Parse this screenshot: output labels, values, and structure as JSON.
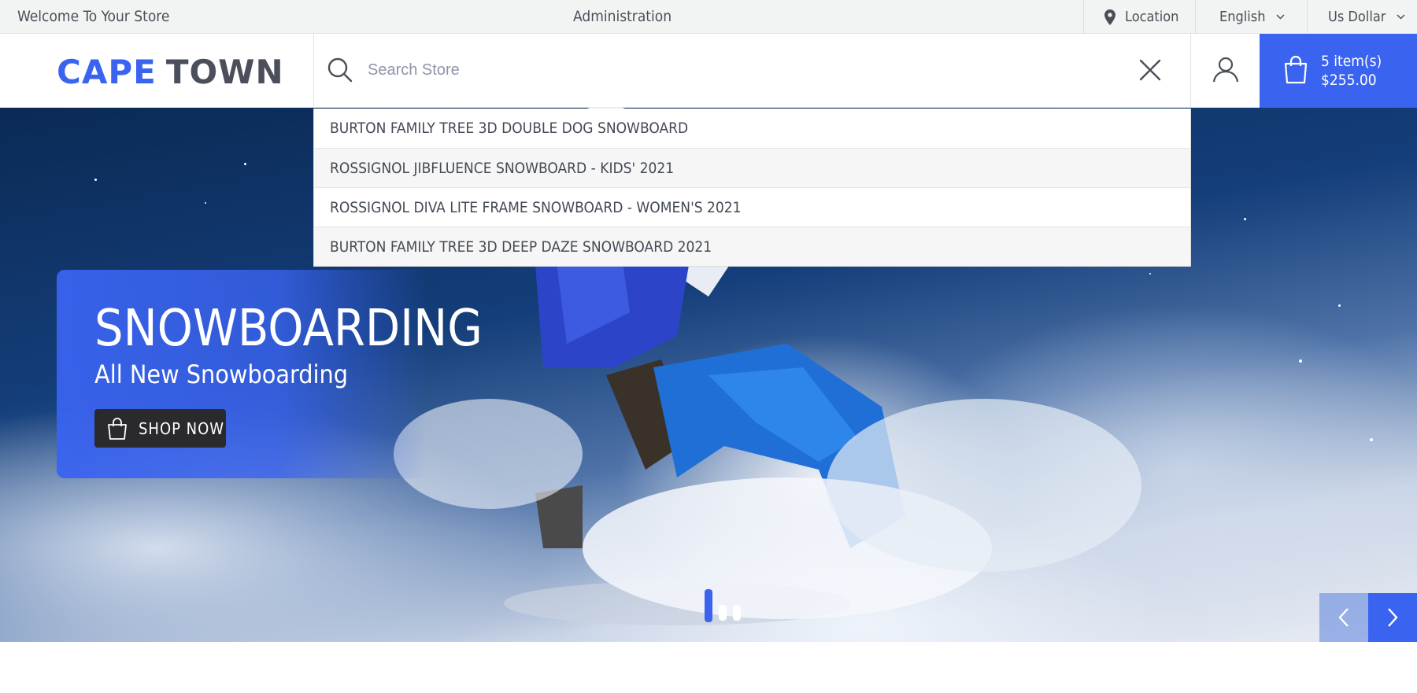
{
  "topbar": {
    "welcome": "Welcome To Your Store",
    "admin": "Administration",
    "location": {
      "label": "Location",
      "icon": "map-pin-icon"
    },
    "language": {
      "label": "English",
      "icon": "chevron-down-icon"
    },
    "currency": {
      "label": "Us Dollar",
      "icon": "chevron-down-icon"
    }
  },
  "header": {
    "logo": {
      "part1": "CAPE",
      "part2": "TOWN"
    },
    "search": {
      "placeholder": "Search Store",
      "value": "",
      "icon": "search-icon",
      "clear_icon": "close-icon"
    },
    "account_icon": "user-icon",
    "cart": {
      "icon": "shopping-bag-icon",
      "items": "5 item(s)",
      "total": "$255.00"
    }
  },
  "suggestions": [
    "BURTON FAMILY TREE 3D DOUBLE DOG SNOWBOARD",
    "ROSSIGNOL JIBFLUENCE SNOWBOARD - KIDS' 2021",
    "ROSSIGNOL DIVA LITE FRAME SNOWBOARD - WOMEN'S 2021",
    "BURTON FAMILY TREE 3D DEEP DAZE SNOWBOARD 2021"
  ],
  "hero": {
    "title": "SNOWBOARDING",
    "subtitle": "All New Snowboarding",
    "cta": {
      "label": "SHOP NOW",
      "icon": "shopping-bag-icon"
    },
    "slides": 3,
    "active_slide": 1,
    "prev_icon": "chevron-left-icon",
    "next_icon": "chevron-right-icon"
  },
  "colors": {
    "accent": "#3a63f0",
    "topbar_bg": "#f2f4f4",
    "button_dark": "#2a2a2c",
    "text_dark": "#4a4f57"
  }
}
